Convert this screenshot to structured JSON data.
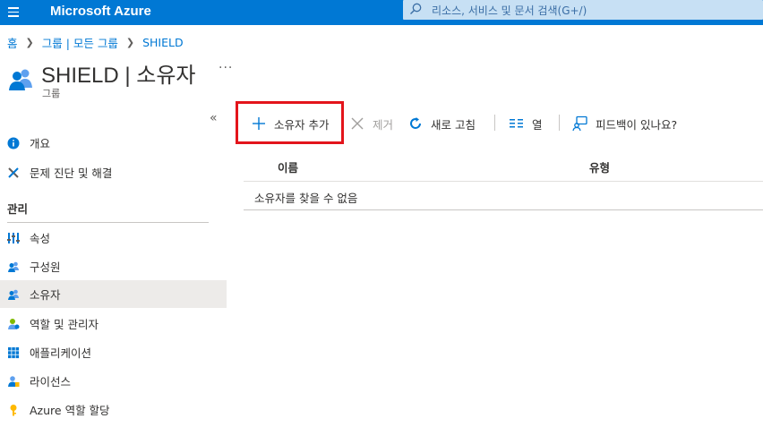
{
  "topbar": {
    "brand": "Microsoft Azure",
    "search_placeholder": "리소스, 서비스 및 문서 검색(G+/)",
    "accent_color": "#0078d4"
  },
  "breadcrumb": [
    "홈",
    "그룹 | 모든 그룹",
    "SHIELD"
  ],
  "header": {
    "title": "SHIELD | 소유자",
    "subtitle": "그룹",
    "more": "···"
  },
  "sidebar": {
    "collapse": "«",
    "section_label": "관리",
    "items": [
      {
        "label": "개요",
        "icon": "info-icon"
      },
      {
        "label": "문제 진단 및 해결",
        "icon": "wrench-icon"
      },
      {
        "label": "속성",
        "icon": "properties-icon"
      },
      {
        "label": "구성원",
        "icon": "members-icon"
      },
      {
        "label": "소유자",
        "icon": "owners-icon",
        "active": true
      },
      {
        "label": "역할 및 관리자",
        "icon": "roles-icon"
      },
      {
        "label": "애플리케이션",
        "icon": "applications-icon"
      },
      {
        "label": "라이선스",
        "icon": "licenses-icon"
      },
      {
        "label": "Azure 역할 할당",
        "icon": "key-icon"
      }
    ]
  },
  "toolbar": {
    "add_owner": "소유자 추가",
    "remove": "제거",
    "refresh": "새로 고침",
    "columns": "열",
    "feedback": "피드백이 있나요?",
    "highlight_color": "#e3141b"
  },
  "table": {
    "columns": [
      "이름",
      "유형"
    ],
    "empty_message": "소유자를 찾을 수 없음"
  }
}
